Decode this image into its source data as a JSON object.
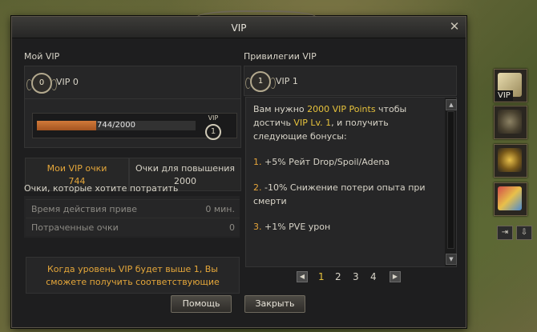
{
  "window": {
    "title": "VIP"
  },
  "left": {
    "section_title": "Мой VIP",
    "vip_label": "VIP 0",
    "medal_level": "0",
    "progress": {
      "text": "744/2000",
      "fraction": 0.372
    },
    "badge": {
      "label": "VIP",
      "level": "1"
    },
    "stats": [
      {
        "title": "Мои VIP очки",
        "value": "744"
      },
      {
        "title": "Очки для повышения",
        "value": "2000"
      }
    ],
    "spend_title": "Очки, которые хотите потратить",
    "rows": [
      {
        "label": "Время действия приве",
        "value": "0 мин."
      },
      {
        "label": "Потраченные очки",
        "value": "0"
      }
    ],
    "note": "Когда уровень VIP будет выше 1, Вы сможете получить соответствующие"
  },
  "right": {
    "section_title": "Привилегии VIP",
    "vip_label": "VIP 1",
    "medal_level": "1",
    "intro": {
      "a": "Вам нужно ",
      "b": "2000 VIP Points",
      "c": " чтобы достичь ",
      "d": "VIP Lv. 1",
      "e": ", и получить следующие бонусы:"
    },
    "bonuses": [
      {
        "num": "1.",
        "text": " +5% Рейт Drop/Spoil/Adena"
      },
      {
        "num": "2.",
        "text": " -10% Снижение потери опыта при смерти"
      },
      {
        "num": "3.",
        "text": " +1% PVE урон"
      }
    ],
    "pages": [
      "1",
      "2",
      "3",
      "4"
    ],
    "active_page": "1"
  },
  "buttons": {
    "help": "Помощь",
    "close": "Закрыть"
  },
  "sidebar": {
    "vip_tag": "VIP"
  },
  "colors": {
    "accent": "#e6c23c",
    "orange": "#e6a53a",
    "progress": "#c06a2c"
  }
}
